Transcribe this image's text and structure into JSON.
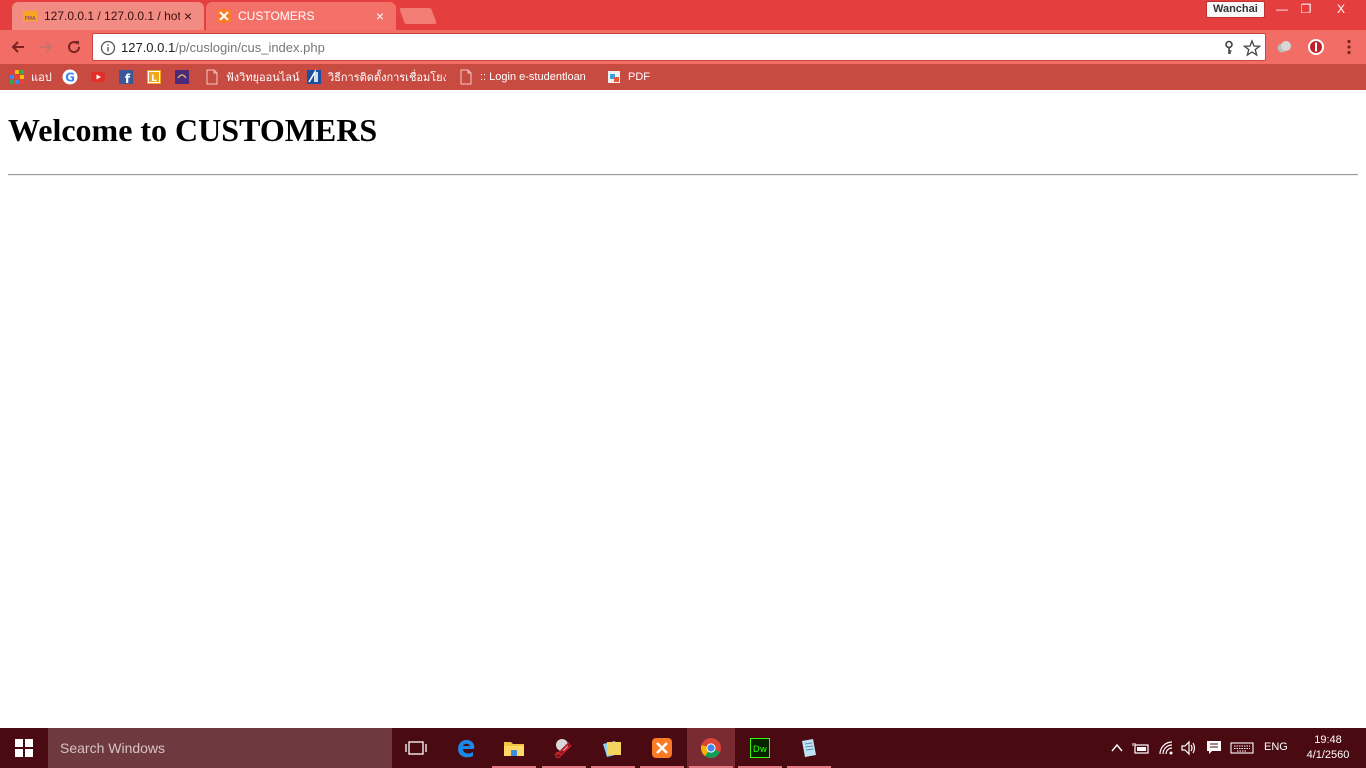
{
  "browser": {
    "tabs": [
      {
        "title": "127.0.0.1 / 127.0.0.1 / hot",
        "favicon": "phpmyadmin-icon",
        "active": false
      },
      {
        "title": "CUSTOMERS",
        "favicon": "xampp-icon",
        "active": true
      }
    ],
    "tab_close_glyph": "×",
    "profile_name": "Wanchai",
    "window_controls": {
      "minimize": "—",
      "maximize": "❐",
      "close": "X"
    },
    "address": {
      "host": "127.0.0.1",
      "path": "/p/cuslogin/cus_index.php"
    },
    "bookmarks": [
      {
        "label": "แอป",
        "icon": "apps-grid-icon"
      },
      {
        "label": "",
        "icon": "google-icon"
      },
      {
        "label": "",
        "icon": "youtube-icon"
      },
      {
        "label": "",
        "icon": "facebook-icon"
      },
      {
        "label": "",
        "icon": "lightroom-icon"
      },
      {
        "label": "",
        "icon": "scb-icon"
      },
      {
        "label": "ฟังวิทยุออนไลน์",
        "icon": "page-icon"
      },
      {
        "label": "วิธีการติดตั้งการเชื่อมโยงฯ",
        "icon": "app-icon"
      },
      {
        "label": ":: Login e-studentloan",
        "icon": "page-icon"
      },
      {
        "label": "PDF",
        "icon": "pdf-icon"
      }
    ],
    "colors": {
      "tabstrip": "#e53e3e",
      "toolbar": "#f26d65",
      "bookmarks": "#c84b42"
    }
  },
  "page": {
    "heading": "Welcome to CUSTOMERS"
  },
  "taskbar": {
    "search_placeholder": "Search Windows",
    "apps": [
      {
        "icon": "task-view-icon"
      },
      {
        "icon": "edge-icon"
      },
      {
        "icon": "file-explorer-icon"
      },
      {
        "icon": "snipping-tool-icon"
      },
      {
        "icon": "folder-photos-icon"
      },
      {
        "icon": "xampp-icon"
      },
      {
        "icon": "chrome-icon"
      },
      {
        "icon": "dreamweaver-icon"
      },
      {
        "icon": "notepad-icon"
      }
    ],
    "language": "ENG",
    "time": "19:48",
    "date": "4/1/2560"
  }
}
